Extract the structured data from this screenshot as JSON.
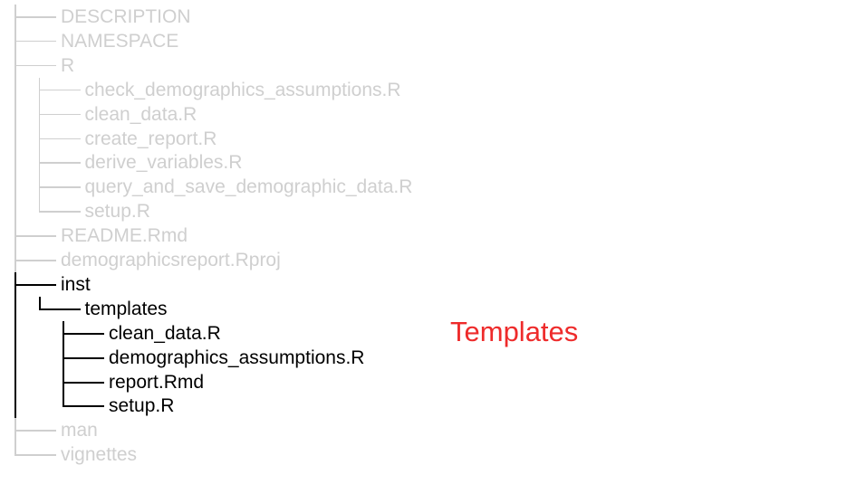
{
  "colors": {
    "dimmed": "#cfcfcf",
    "highlight": "#000000",
    "annotation": "#ee2b2b"
  },
  "tree": {
    "items": [
      {
        "label": "DESCRIPTION",
        "depth": 0,
        "highlighted": false,
        "icon": "file-icon"
      },
      {
        "label": "NAMESPACE",
        "depth": 0,
        "highlighted": false,
        "icon": "file-icon"
      },
      {
        "label": "R",
        "depth": 0,
        "highlighted": false,
        "icon": "folder-icon"
      },
      {
        "label": "check_demographics_assumptions.R",
        "depth": 1,
        "highlighted": false,
        "icon": "file-icon"
      },
      {
        "label": "clean_data.R",
        "depth": 1,
        "highlighted": false,
        "icon": "file-icon"
      },
      {
        "label": "create_report.R",
        "depth": 1,
        "highlighted": false,
        "icon": "file-icon"
      },
      {
        "label": "derive_variables.R",
        "depth": 1,
        "highlighted": false,
        "icon": "file-icon"
      },
      {
        "label": "query_and_save_demographic_data.R",
        "depth": 1,
        "highlighted": false,
        "icon": "file-icon"
      },
      {
        "label": "setup.R",
        "depth": 1,
        "highlighted": false,
        "icon": "file-icon"
      },
      {
        "label": "README.Rmd",
        "depth": 0,
        "highlighted": false,
        "icon": "file-icon"
      },
      {
        "label": "demographicsreport.Rproj",
        "depth": 0,
        "highlighted": false,
        "icon": "file-icon"
      },
      {
        "label": "inst",
        "depth": 0,
        "highlighted": true,
        "icon": "folder-icon"
      },
      {
        "label": "templates",
        "depth": 1,
        "highlighted": true,
        "icon": "folder-icon"
      },
      {
        "label": "clean_data.R",
        "depth": 2,
        "highlighted": true,
        "icon": "file-icon"
      },
      {
        "label": "demographics_assumptions.R",
        "depth": 2,
        "highlighted": true,
        "icon": "file-icon"
      },
      {
        "label": "report.Rmd",
        "depth": 2,
        "highlighted": true,
        "icon": "file-icon"
      },
      {
        "label": "setup.R",
        "depth": 2,
        "highlighted": true,
        "icon": "file-icon"
      },
      {
        "label": "man",
        "depth": 0,
        "highlighted": false,
        "icon": "folder-icon"
      },
      {
        "label": "vignettes",
        "depth": 0,
        "highlighted": false,
        "icon": "folder-icon"
      }
    ]
  },
  "annotation": {
    "text": "Templates"
  }
}
